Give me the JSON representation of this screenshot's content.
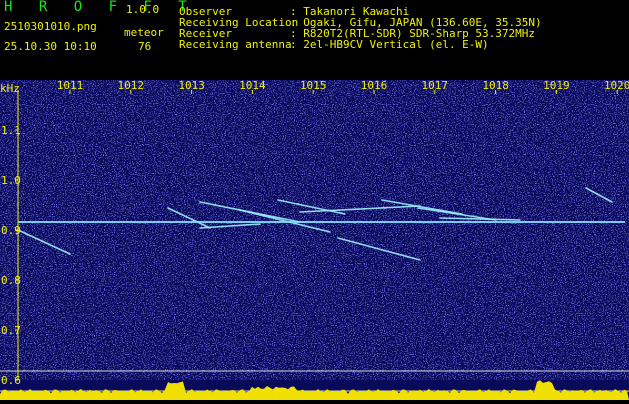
{
  "app": {
    "name": "H R O F F T",
    "version": "1.0.0"
  },
  "file": {
    "name": "2510301010.png",
    "datetime": "25.10.30 10:10"
  },
  "meteor": {
    "label": "meteor",
    "count": "76"
  },
  "info": {
    "observer_label": "Observer",
    "observer_value": ": Takanori Kawachi",
    "location_label": "Receiving Location",
    "location_value": ": Ogaki, Gifu, JAPAN (136.60E, 35.35N)",
    "receiver_label": "Receiver",
    "receiver_value": ": R820T2(RTL-SDR) SDR-Sharp 53.372MHz",
    "antenna_label": "Receiving antenna",
    "antenna_value": ": 2el-HB9CV Vertical (el. E-W)"
  },
  "axis": {
    "unit": "kHz",
    "time_ticks": [
      "1011",
      "1012",
      "1013",
      "1014",
      "1015",
      "1016",
      "1017",
      "1018",
      "1019",
      "1020"
    ],
    "freq_ticks": [
      "1.1",
      "1.0",
      "0.9",
      "0.8",
      "0.7",
      "0.6"
    ]
  },
  "colors": {
    "background": "#0a0a5a",
    "noise": "#3a3ad8",
    "carrier": "#7fe0ff",
    "echo": "#9ef0ff",
    "amplitude": "#f0e000",
    "text_green": "#18e818",
    "text_yellow": "#f2f200"
  }
}
